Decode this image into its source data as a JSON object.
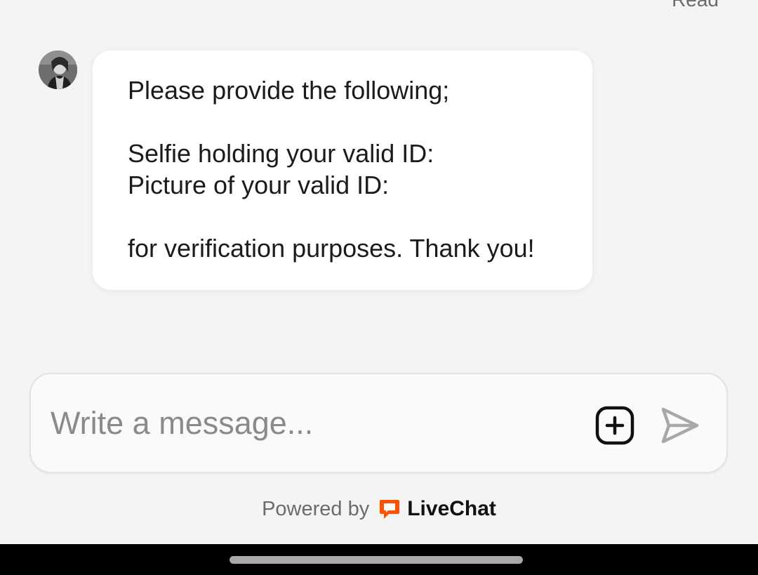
{
  "chat": {
    "read_status": "Read",
    "message": {
      "sender_avatar": "agent-avatar-photo",
      "lines": [
        "Please provide the following;",
        "",
        "Selfie holding your valid ID:",
        "Picture of your valid ID:",
        "",
        "for verification purposes. Thank you!"
      ]
    }
  },
  "composer": {
    "placeholder": "Write a message...",
    "value": "",
    "add_icon": "plus-square-icon",
    "send_icon": "send-arrow-icon"
  },
  "footer": {
    "powered_by": "Powered by",
    "brand_name": "LiveChat",
    "brand_icon": "livechat-logo-icon",
    "brand_color": "#ff5100"
  },
  "system": {
    "nav_bar_color": "#000000",
    "home_indicator": "home-indicator"
  }
}
